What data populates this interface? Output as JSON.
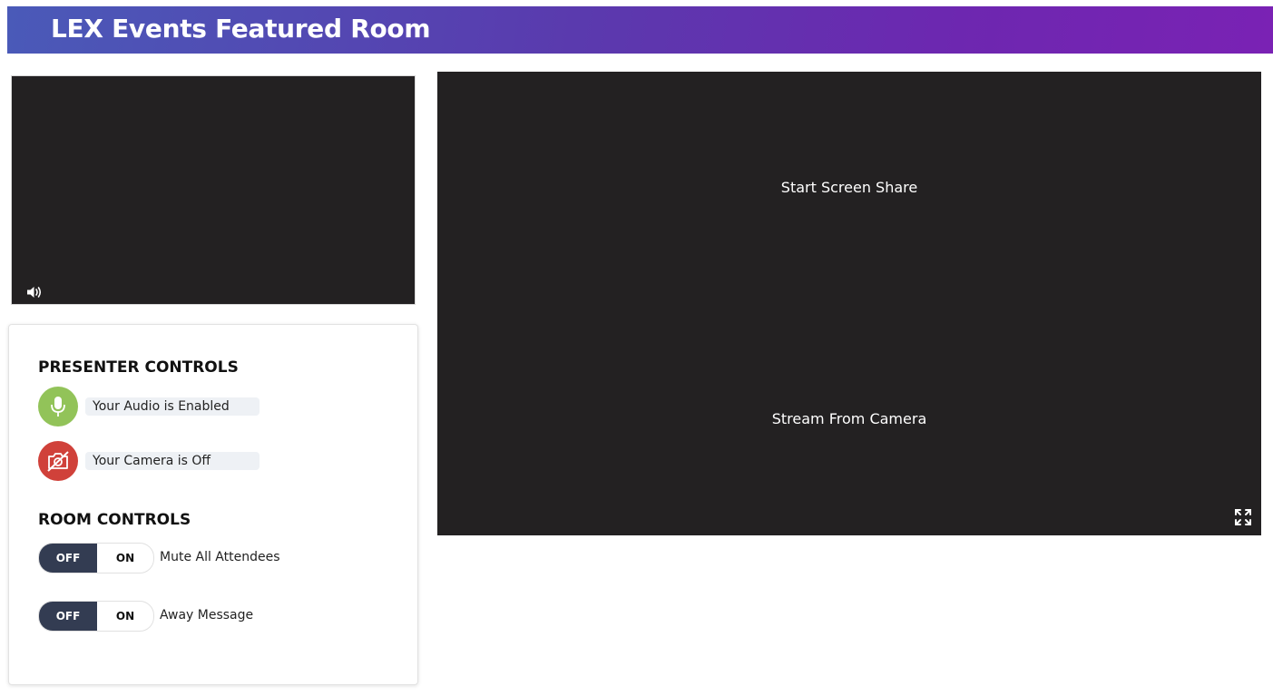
{
  "header": {
    "title": "LEX Events Featured Room"
  },
  "video_small": {
    "volume_icon": "volume-icon"
  },
  "presenter_controls": {
    "title": "PRESENTER CONTROLS",
    "audio": {
      "label": "Your Audio is Enabled",
      "icon": "microphone-icon",
      "color": "#92c359"
    },
    "camera": {
      "label": "Your Camera is Off",
      "icon": "camera-off-icon",
      "color": "#d0413a"
    }
  },
  "room_controls": {
    "title": "ROOM CONTROLS",
    "toggles": [
      {
        "off_label": "OFF",
        "on_label": "ON",
        "label": "Mute All Attendees",
        "state": "OFF"
      },
      {
        "off_label": "OFF",
        "on_label": "ON",
        "label": "Away Message",
        "state": "OFF"
      }
    ]
  },
  "main_video": {
    "screen_share_label": "Start Screen Share",
    "camera_label": "Stream From Camera",
    "fullscreen_icon": "fullscreen-icon"
  },
  "colors": {
    "banner_start": "#4a5ab8",
    "banner_end": "#7a22b4",
    "video_bg": "#232122",
    "toggle_active": "#333c52"
  }
}
